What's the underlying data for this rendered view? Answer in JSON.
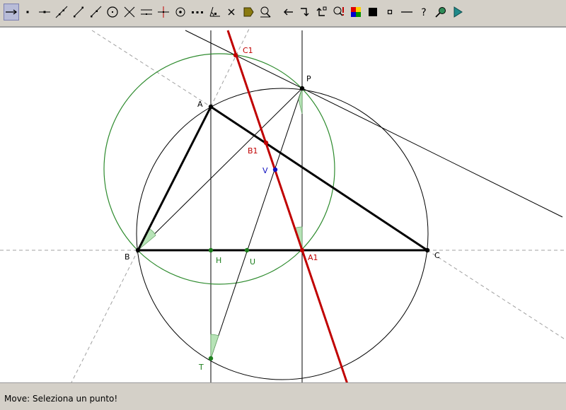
{
  "toolbar": {
    "tools": [
      {
        "name": "move-tool-icon",
        "active": true
      },
      {
        "name": "new-point-tool-icon"
      },
      {
        "name": "point-on-object-tool-icon"
      },
      {
        "name": "line-through-two-points-tool-icon"
      },
      {
        "name": "segment-tool-icon"
      },
      {
        "name": "ray-tool-icon"
      },
      {
        "name": "circle-with-center-tool-icon"
      },
      {
        "name": "intersect-tool-icon"
      },
      {
        "name": "parallel-line-tool-icon"
      },
      {
        "name": "perpendicular-line-tool-icon"
      },
      {
        "name": "circle-center-point-tool-icon"
      },
      {
        "name": "locus-tool-icon"
      },
      {
        "name": "delete-tool-icon"
      },
      {
        "name": "angle-tool-icon"
      },
      {
        "name": "mirror-tool-icon"
      },
      {
        "name": "rotate-tool-icon"
      },
      {
        "name": "undo-tool-icon"
      },
      {
        "name": "redo-tool-icon"
      },
      {
        "name": "redo-all-tool-icon"
      },
      {
        "name": "show-construction-tool-icon"
      },
      {
        "name": "color-palette-tool-icon"
      },
      {
        "name": "black-square-tool-icon"
      },
      {
        "name": "small-square-tool-icon"
      },
      {
        "name": "line-style-tool-icon"
      },
      {
        "name": "help-tool-icon"
      },
      {
        "name": "zoom-tool-icon"
      },
      {
        "name": "play-tool-icon"
      }
    ]
  },
  "labels": {
    "A": "A",
    "B": "B",
    "C": "C",
    "P": "P",
    "H": "H",
    "U": "U",
    "T": "T",
    "V": "V",
    "A1": "A1",
    "B1": "B1",
    "C1": "C1"
  },
  "colors": {
    "triangle": "#000000",
    "simson_line": "#c00000",
    "circle_green": "#2e8b2e",
    "green_point": "#1e7e1e",
    "blue_point": "#1010c0",
    "dashed": "#a0a0a0"
  },
  "status": {
    "message": "Move: Seleziona un punto!"
  }
}
